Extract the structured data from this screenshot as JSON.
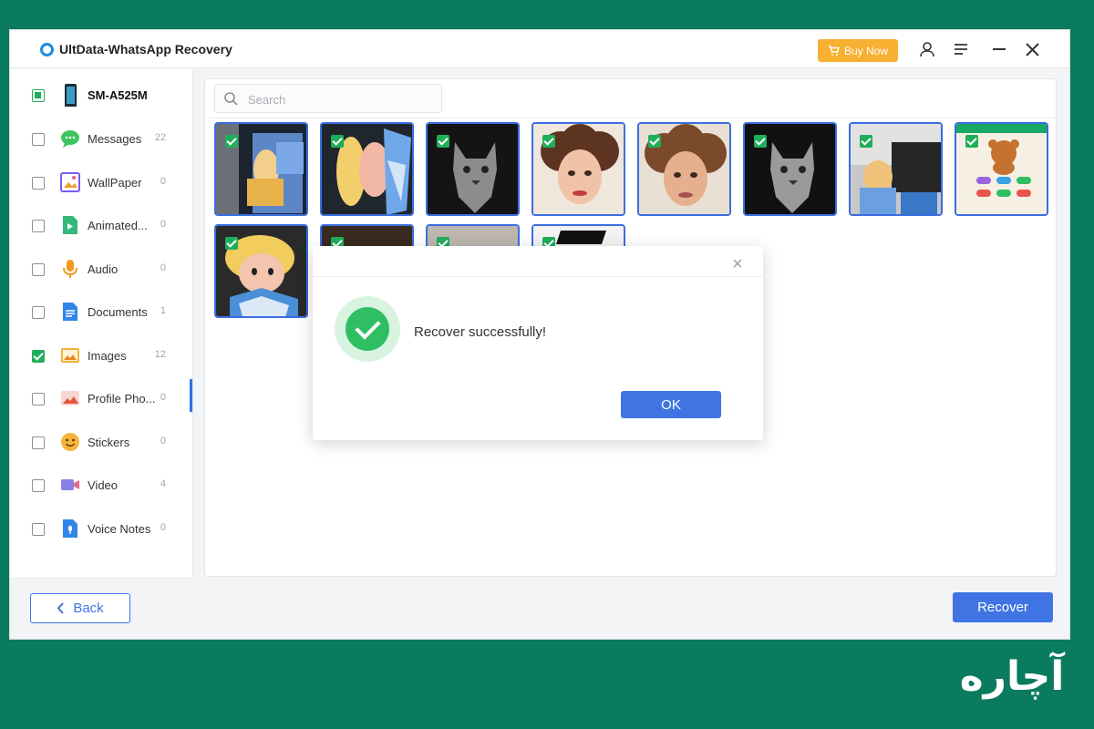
{
  "app": {
    "title": "UltData-WhatsApp Recovery",
    "buy_label": "Buy Now",
    "brand_color": "#1a8de0",
    "accent": "#3f74e2"
  },
  "sidebar": {
    "device": "SM-A525M",
    "items": [
      {
        "label": "Messages",
        "count": "22",
        "checked": false,
        "icon": "chat-bubble-icon"
      },
      {
        "label": "WallPaper",
        "count": "0",
        "checked": false,
        "icon": "wallpaper-icon"
      },
      {
        "label": "Animated...",
        "count": "0",
        "checked": false,
        "icon": "animated-gif-icon"
      },
      {
        "label": "Audio",
        "count": "0",
        "checked": false,
        "icon": "microphone-icon"
      },
      {
        "label": "Documents",
        "count": "1",
        "checked": false,
        "icon": "document-icon"
      },
      {
        "label": "Images",
        "count": "12",
        "checked": true,
        "icon": "image-icon"
      },
      {
        "label": "Profile Pho...",
        "count": "0",
        "checked": false,
        "icon": "profile-photo-icon"
      },
      {
        "label": "Stickers",
        "count": "0",
        "checked": false,
        "icon": "sticker-face-icon"
      },
      {
        "label": "Video",
        "count": "4",
        "checked": false,
        "icon": "video-camera-icon"
      },
      {
        "label": "Voice Notes",
        "count": "0",
        "checked": false,
        "icon": "voice-note-icon"
      }
    ]
  },
  "search": {
    "placeholder": "Search"
  },
  "grid": {
    "thumbnail_count": 12,
    "all_checked": true
  },
  "dialog": {
    "message": "Recover successfully!",
    "ok_label": "OK"
  },
  "footer": {
    "back_label": "Back",
    "recover_label": "Recover"
  },
  "watermark": {
    "text": "آچاره"
  }
}
